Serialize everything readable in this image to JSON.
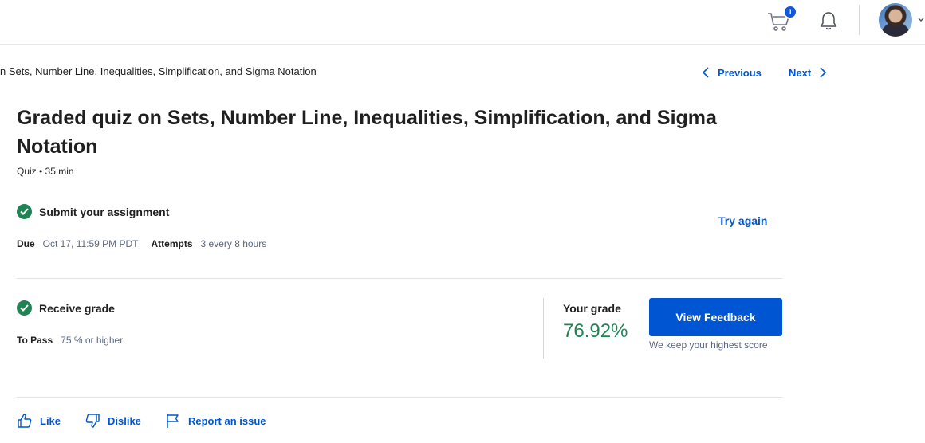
{
  "header": {
    "cart_count": "1",
    "icons": {
      "cart": "cart-icon",
      "bell": "bell-icon",
      "avatar": "user-avatar"
    }
  },
  "breadcrumb": {
    "text": "n Sets, Number Line, Inequalities, Simplification, and Sigma Notation"
  },
  "nav": {
    "previous_label": "Previous",
    "next_label": "Next"
  },
  "quiz": {
    "title": "Graded quiz on Sets, Number Line, Inequalities, Simplification, and Sigma Notation",
    "meta": "Quiz • 35 min"
  },
  "submit": {
    "heading": "Submit your assignment",
    "due_label": "Due",
    "due_value": "Oct 17, 11:59 PM PDT",
    "attempts_label": "Attempts",
    "attempts_value": "3 every 8 hours",
    "try_again_label": "Try again"
  },
  "receive": {
    "heading": "Receive grade",
    "to_pass_label": "To Pass",
    "to_pass_value": "75 % or higher",
    "your_grade_label": "Your grade",
    "your_grade_value": "76.92%",
    "view_feedback_label": "View Feedback",
    "keep_score_note": "We keep your highest score"
  },
  "actions": {
    "like_label": "Like",
    "dislike_label": "Dislike",
    "report_label": "Report an issue"
  },
  "colors": {
    "accent": "#0056d2",
    "success": "#1f8354",
    "text": "#1f1f1f",
    "muted": "#5b6780"
  }
}
